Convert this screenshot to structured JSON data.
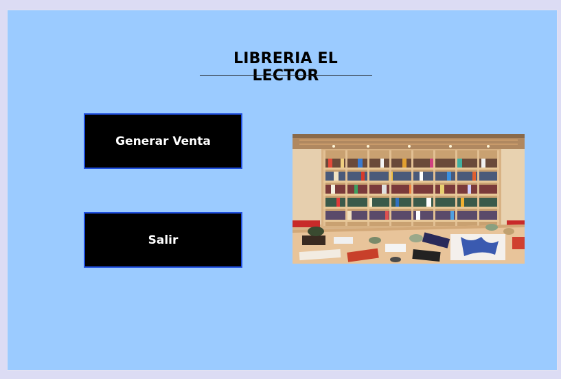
{
  "app": {
    "title": "LIBRERIA EL LECTOR"
  },
  "buttons": {
    "generar_venta": "Generar Venta",
    "salir": "Salir"
  },
  "image": {
    "icon": "bookstore-photo"
  },
  "colors": {
    "background": "#9bcbff",
    "button_bg": "#000000",
    "button_border": "#1f4fe0",
    "button_text": "#ffffff"
  }
}
